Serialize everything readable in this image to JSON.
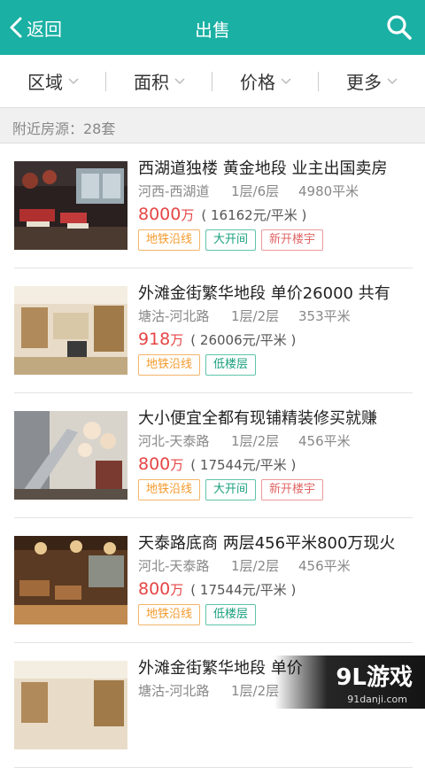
{
  "header": {
    "back_label": "返回",
    "title": "出售",
    "colors": {
      "bar": "#1ab0a4"
    }
  },
  "filters": [
    {
      "label": "区域",
      "icon": "chevron-down-icon"
    },
    {
      "label": "面积",
      "icon": "chevron-down-icon"
    },
    {
      "label": "价格",
      "icon": "chevron-down-icon"
    },
    {
      "label": "更多",
      "icon": "chevron-down-icon"
    }
  ],
  "nearby": {
    "text": "附近房源：28套"
  },
  "listings": [
    {
      "title": "西湖道独楼 黄金地段 业主出国卖房",
      "area": "河西-西湖道",
      "floor": "1层/6层",
      "size": "4980平米",
      "price": "8000",
      "price_unit": "万",
      "unit_price": "( 16162元/平米 )",
      "tags": [
        {
          "text": "地铁沿线",
          "style": "orange"
        },
        {
          "text": "大开间",
          "style": "green"
        },
        {
          "text": "新开楼宇",
          "style": "red"
        }
      ]
    },
    {
      "title": "外滩金街繁华地段 单价26000 共有",
      "area": "塘沽-河北路",
      "floor": "1层/2层",
      "size": "353平米",
      "price": "918",
      "price_unit": "万",
      "unit_price": "( 26006元/平米 )",
      "tags": [
        {
          "text": "地铁沿线",
          "style": "orange"
        },
        {
          "text": "低楼层",
          "style": "green"
        }
      ]
    },
    {
      "title": "大小便宜全都有现铺精装修买就赚",
      "area": "河北-天泰路",
      "floor": "1层/2层",
      "size": "456平米",
      "price": "800",
      "price_unit": "万",
      "unit_price": "( 17544元/平米 )",
      "tags": [
        {
          "text": "地铁沿线",
          "style": "orange"
        },
        {
          "text": "大开间",
          "style": "green"
        },
        {
          "text": "新开楼宇",
          "style": "red"
        }
      ]
    },
    {
      "title": "天泰路底商 两层456平米800万现火",
      "area": "河北-天泰路",
      "floor": "1层/2层",
      "size": "456平米",
      "price": "800",
      "price_unit": "万",
      "unit_price": "( 17544元/平米 )",
      "tags": [
        {
          "text": "地铁沿线",
          "style": "orange"
        },
        {
          "text": "低楼层",
          "style": "green"
        }
      ]
    },
    {
      "title": "外滩金街繁华地段 单价",
      "area": "塘沽-河北路",
      "floor": "1层/2层",
      "size": "",
      "price": "",
      "price_unit": "",
      "unit_price": "",
      "tags": []
    }
  ],
  "watermark": {
    "brand": "9L游戏",
    "site": "91danji.com"
  }
}
